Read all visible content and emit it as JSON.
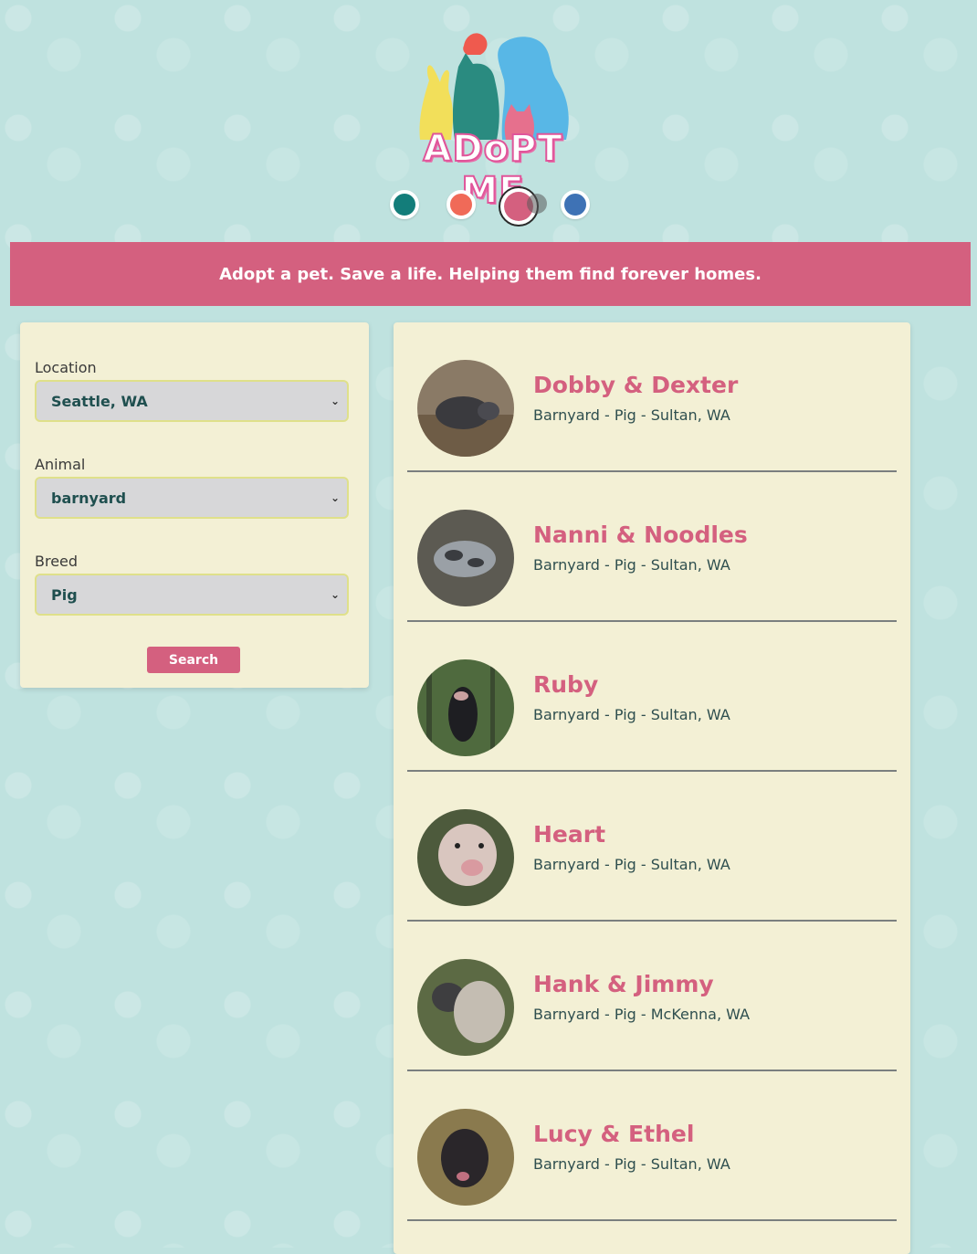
{
  "logo": {
    "text": "ADoPT ME"
  },
  "themes": [
    {
      "name": "teal",
      "color": "#137d7a"
    },
    {
      "name": "coral",
      "color": "#f06a58"
    },
    {
      "name": "pink",
      "color": "#d4607f",
      "selected": true
    },
    {
      "name": "blue",
      "color": "#3e72b5"
    }
  ],
  "banner": {
    "tagline": "Adopt a pet. Save a life. Helping them find forever homes."
  },
  "search": {
    "location_label": "Location",
    "location_value": "Seattle, WA",
    "animal_label": "Animal",
    "animal_value": "barnyard",
    "breed_label": "Breed",
    "breed_value": "Pig",
    "button_label": "Search"
  },
  "pets": [
    {
      "name": "Dobby & Dexter",
      "meta": "Barnyard - Pig - Sultan, WA"
    },
    {
      "name": "Nanni & Noodles",
      "meta": "Barnyard - Pig - Sultan, WA"
    },
    {
      "name": "Ruby",
      "meta": "Barnyard - Pig - Sultan, WA"
    },
    {
      "name": "Heart",
      "meta": "Barnyard - Pig - Sultan, WA"
    },
    {
      "name": "Hank & Jimmy",
      "meta": "Barnyard - Pig - McKenna, WA"
    },
    {
      "name": "Lucy & Ethel",
      "meta": "Barnyard - Pig - Sultan, WA"
    }
  ],
  "colors": {
    "accent": "#d4607f",
    "background": "#bfe2df",
    "panel": "#f3f0d5"
  }
}
